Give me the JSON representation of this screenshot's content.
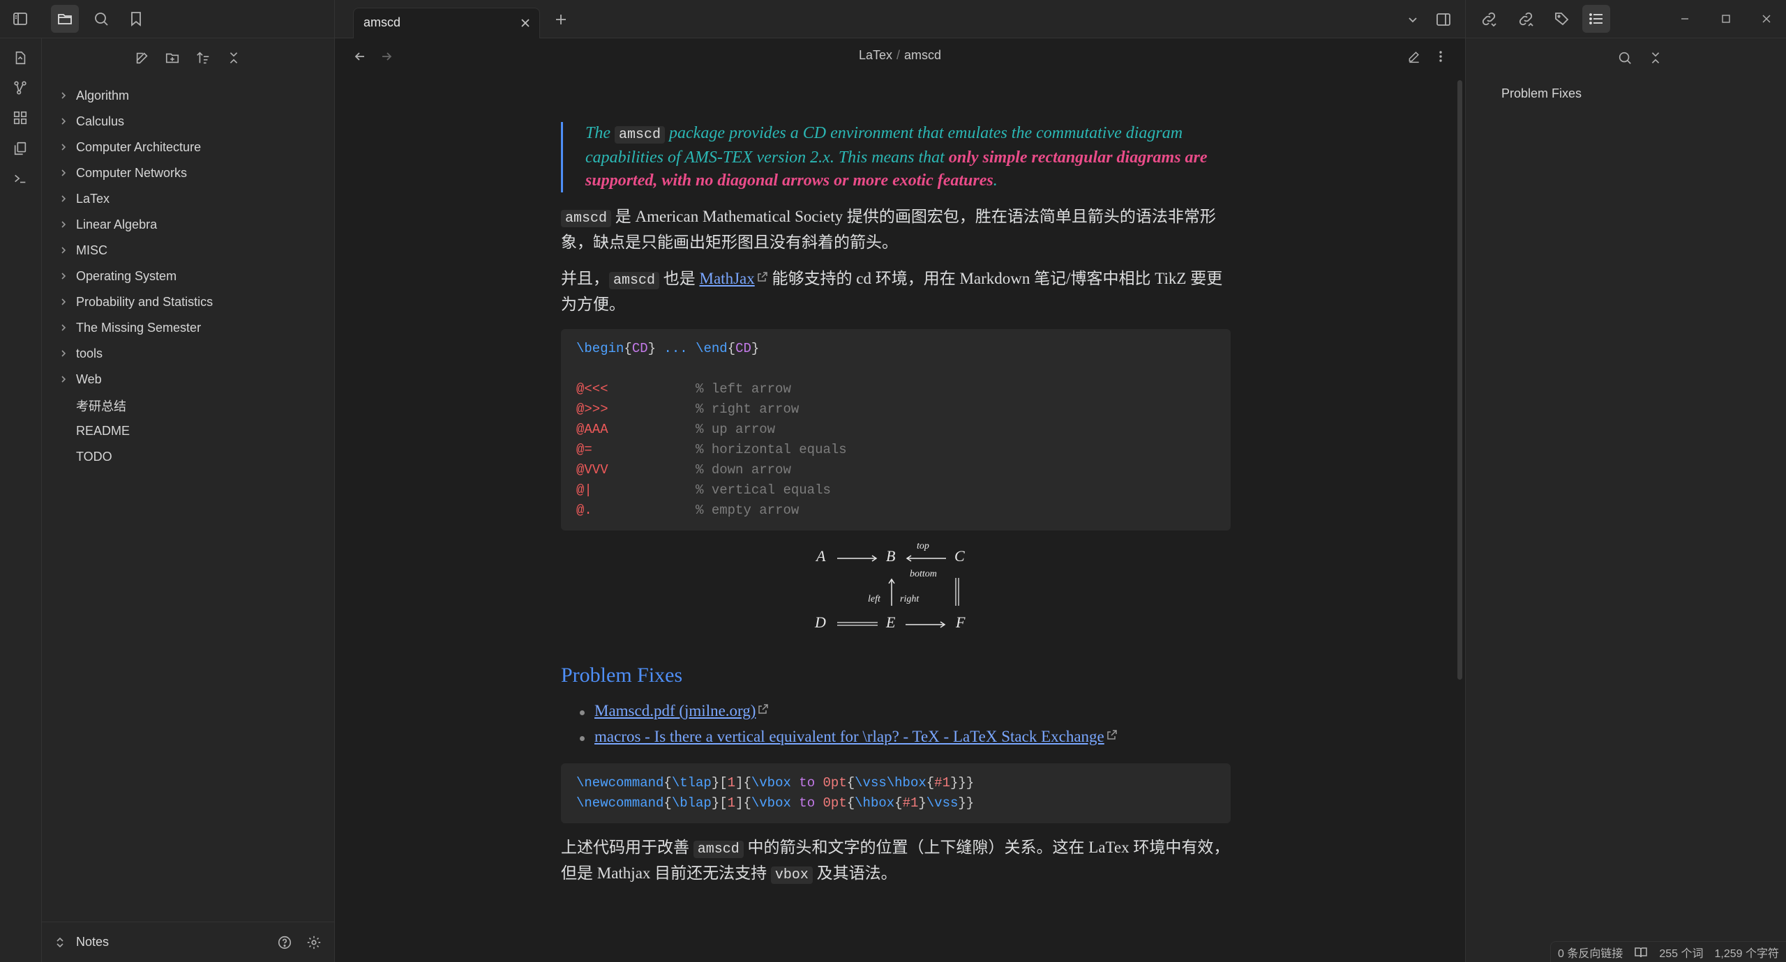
{
  "tabs": [
    {
      "title": "amscd"
    }
  ],
  "breadcrumb": {
    "folder": "LaTex",
    "separator": "/",
    "file": "amscd"
  },
  "explorer": {
    "items": [
      {
        "label": "Algorithm",
        "folder": true
      },
      {
        "label": "Calculus",
        "folder": true
      },
      {
        "label": "Computer Architecture",
        "folder": true
      },
      {
        "label": "Computer Networks",
        "folder": true
      },
      {
        "label": "LaTex",
        "folder": true
      },
      {
        "label": "Linear Algebra",
        "folder": true
      },
      {
        "label": "MISC",
        "folder": true
      },
      {
        "label": "Operating System",
        "folder": true
      },
      {
        "label": "Probability and Statistics",
        "folder": true
      },
      {
        "label": "The Missing Semester",
        "folder": true
      },
      {
        "label": "tools",
        "folder": true
      },
      {
        "label": "Web",
        "folder": true
      },
      {
        "label": "考研总结",
        "folder": false
      },
      {
        "label": "README",
        "folder": false
      },
      {
        "label": "TODO",
        "folder": false
      }
    ],
    "vault_name": "Notes"
  },
  "doc": {
    "quote": {
      "p1": "The ",
      "code": "amscd",
      "p2": " package provides a CD environment that emulates the commutative diagram capabilities of AMS-TEX version 2.x. This means that ",
      "highlight": "only simple rectangular diagrams are supported, with no diagonal arrows or more exotic features",
      "p3": "."
    },
    "para1": {
      "code": "amscd",
      "text": " 是 American Mathematical Society 提供的画图宏包，胜在语法简单且箭头的语法非常形象，缺点是只能画出矩形图且没有斜着的箭头。"
    },
    "para2": {
      "t1": "并且，",
      "code": "amscd",
      "t2": " 也是 ",
      "link": "MathJax",
      "t3": " 能够支持的 cd 环境，用在 Markdown 笔记/博客中相比 TikZ 要更为方便。"
    },
    "code1": {
      "begin": "\\begin",
      "cd": "CD",
      "dots": "...",
      "end": "\\end",
      "rows": [
        {
          "cmd": "@<<<",
          "comment": "% left arrow"
        },
        {
          "cmd": "@>>>",
          "comment": "% right arrow"
        },
        {
          "cmd": "@AAA",
          "comment": "% up arrow"
        },
        {
          "cmd": "@=",
          "comment": "% horizontal equals"
        },
        {
          "cmd": "@VVV",
          "comment": "% down arrow"
        },
        {
          "cmd": "@|",
          "comment": "% vertical equals"
        },
        {
          "cmd": "@.",
          "comment": "% empty arrow"
        }
      ]
    },
    "diagram": {
      "A": "A",
      "B": "B",
      "C": "C",
      "D": "D",
      "E": "E",
      "F": "F",
      "top": "top",
      "bottom": "bottom",
      "left": "left",
      "right": "right"
    },
    "heading": "Problem Fixes",
    "links": [
      "Mamscd.pdf (jmilne.org)",
      "macros - Is there a vertical equivalent for \\rlap? - TeX - LaTeX Stack Exchange"
    ],
    "code2": {
      "newcommand": "\\newcommand",
      "tlap": "\\tlap",
      "blap": "\\blap",
      "n1": "1",
      "vbox": "\\vbox",
      "to": "to",
      "zero": "0pt",
      "vss": "\\vss",
      "hbox": "\\hbox",
      "arg": "#1"
    },
    "para3": {
      "t1": "上述代码用于改善 ",
      "code1": "amscd",
      "t2": " 中的箭头和文字的位置（上下缝隙）关系。这在 LaTex 环境中有效，但是 Mathjax 目前还无法支持 ",
      "code2": "vbox",
      "t3": " 及其语法。"
    }
  },
  "outline": {
    "items": [
      "Problem Fixes"
    ]
  },
  "status": {
    "backlinks": "0 条反向链接",
    "words": "255 个词",
    "chars": "1,259 个字符"
  },
  "colors": {
    "accent": "#4f8ff7",
    "quote_text": "#2bb8b5",
    "highlight": "#ea4c89",
    "link": "#7aa7ff"
  }
}
